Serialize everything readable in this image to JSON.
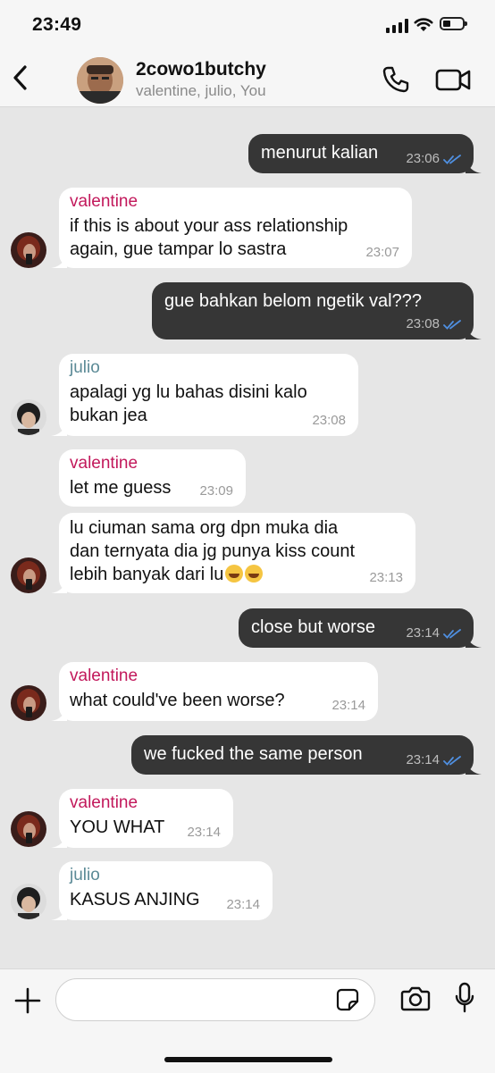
{
  "status": {
    "time": "23:49"
  },
  "chat": {
    "title": "2cowo1butchy",
    "members": "valentine, julio, You"
  },
  "colors": {
    "valentine": "#c2185b",
    "julio": "#5b8a96",
    "read_check": "#4f8fe0"
  },
  "messages": [
    {
      "dir": "out",
      "text": "menurut kalian",
      "time": "23:06",
      "read": true
    },
    {
      "dir": "in",
      "sender": "valentine",
      "text": "if this is about your ass relationship\nagain, gue tampar lo sastra",
      "time": "23:07",
      "avatar": true
    },
    {
      "dir": "out",
      "text": "gue bahkan belom ngetik val???",
      "time": "23:08",
      "read": true
    },
    {
      "dir": "in",
      "sender": "julio",
      "text": "apalagi yg lu bahas disini kalo\nbukan jea",
      "time": "23:08",
      "avatar": true
    },
    {
      "dir": "in",
      "sender": "valentine",
      "text": "let me guess",
      "time": "23:09",
      "avatar": false
    },
    {
      "dir": "in",
      "text": "lu ciuman sama org dpn muka dia\ndan ternyata dia jg punya kiss count\nlebih banyak dari lu",
      "emoji": "rolling-on-floor-laughing x2",
      "time": "23:13",
      "avatar": true
    },
    {
      "dir": "out",
      "text": "close but worse",
      "time": "23:14",
      "read": true
    },
    {
      "dir": "in",
      "sender": "valentine",
      "text": "what could've been worse?",
      "time": "23:14",
      "avatar": true
    },
    {
      "dir": "out",
      "text": "we fucked the same person",
      "time": "23:14",
      "read": true
    },
    {
      "dir": "in",
      "sender": "valentine",
      "text": "YOU WHAT",
      "time": "23:14",
      "avatar": true
    },
    {
      "dir": "in",
      "sender": "julio",
      "text": "KASUS ANJING",
      "time": "23:14",
      "avatar": true
    }
  ],
  "input": {
    "placeholder": ""
  },
  "icons": [
    "back-icon",
    "phone-icon",
    "video-icon",
    "plus-icon",
    "sticker-icon",
    "camera-icon",
    "mic-icon",
    "double-check-icon"
  ]
}
